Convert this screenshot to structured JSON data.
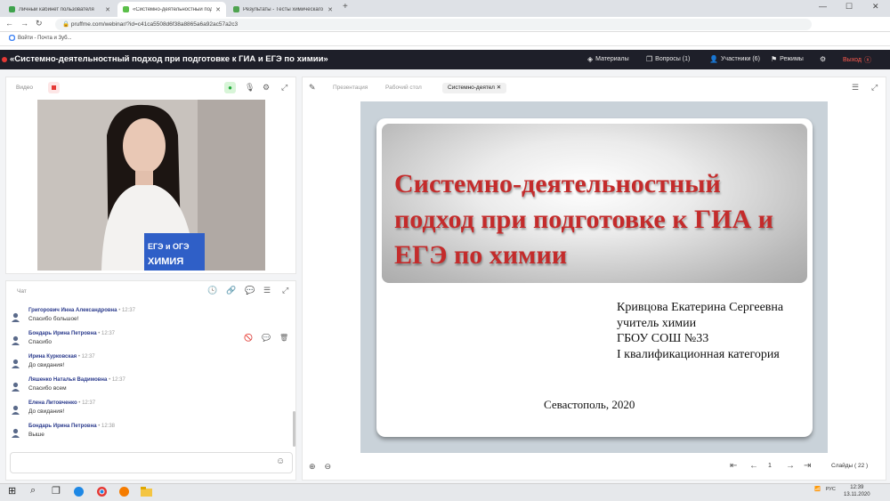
{
  "browser": {
    "tabs": [
      {
        "title": "Личный кабинет пользователя",
        "active": false,
        "fav": "#3fa34d"
      },
      {
        "title": "«Системно-деятельностный подх",
        "active": true,
        "fav": "#5bbf4a"
      },
      {
        "title": "Результаты - Тесты химическаго",
        "active": false,
        "fav": "#4fa34f"
      }
    ],
    "new_tab": "+",
    "url": "pruffme.com/webinar/?id=c41ca5508d6f38a8865a6a92ac57a2c3",
    "bookmark": "Войти - Почта и Зуб...",
    "window_controls": {
      "minimize": "—",
      "maximize": "☐",
      "close": "✕"
    }
  },
  "app": {
    "title": "«Системно-деятельностный подход при подготовке к ГИА и ЕГЭ по химии»",
    "header_buttons": {
      "materials": "Материалы",
      "questions": "Вопросы (1)",
      "participants": "Участники (6)",
      "modes": "Режимы",
      "exit": "Выход"
    },
    "accent": "#e53935"
  },
  "video": {
    "label": "Видео",
    "book_top": "ЕГЭ и ОГЭ",
    "book_bottom": "ХИМИЯ"
  },
  "chat": {
    "label": "Чат",
    "messages": [
      {
        "author": "Григорович Инна Александровна",
        "time": "• 12:37",
        "text": "Спасибо большое!"
      },
      {
        "author": "Бондарь Ирина Петровна",
        "time": "• 12:37",
        "text": "Спасибо"
      },
      {
        "author": "Ирина Курковская",
        "time": "• 12:37",
        "text": "До свидания!"
      },
      {
        "author": "Ляшенко Наталья Вадимовна",
        "time": "• 12:37",
        "text": "Спасибо всем"
      },
      {
        "author": "Елена Литовченко",
        "time": "• 12:37",
        "text": "До свидания!"
      },
      {
        "author": "Бондарь Ирина Петровна",
        "time": "• 12:38",
        "text": "Выше"
      }
    ]
  },
  "presentation": {
    "tabs": [
      "Презентация",
      "Рабочий стол",
      "Системно-деятел"
    ],
    "slide": {
      "title": "Системно-деятельностный подход при подготовке к ГИА и ЕГЭ по химии",
      "author_lines": [
        "Кривцова Екатерина Сергеевна",
        "учитель химии",
        "ГБОУ СОШ №33",
        "I квалификационная категория"
      ],
      "footer": "Севастополь, 2020",
      "title_color": "#c42b2b"
    },
    "page": "1",
    "slides_count": "Слайды ( 22 )"
  },
  "taskbar": {
    "language": "РУС",
    "time": "12:39",
    "date": "13.11.2020"
  }
}
